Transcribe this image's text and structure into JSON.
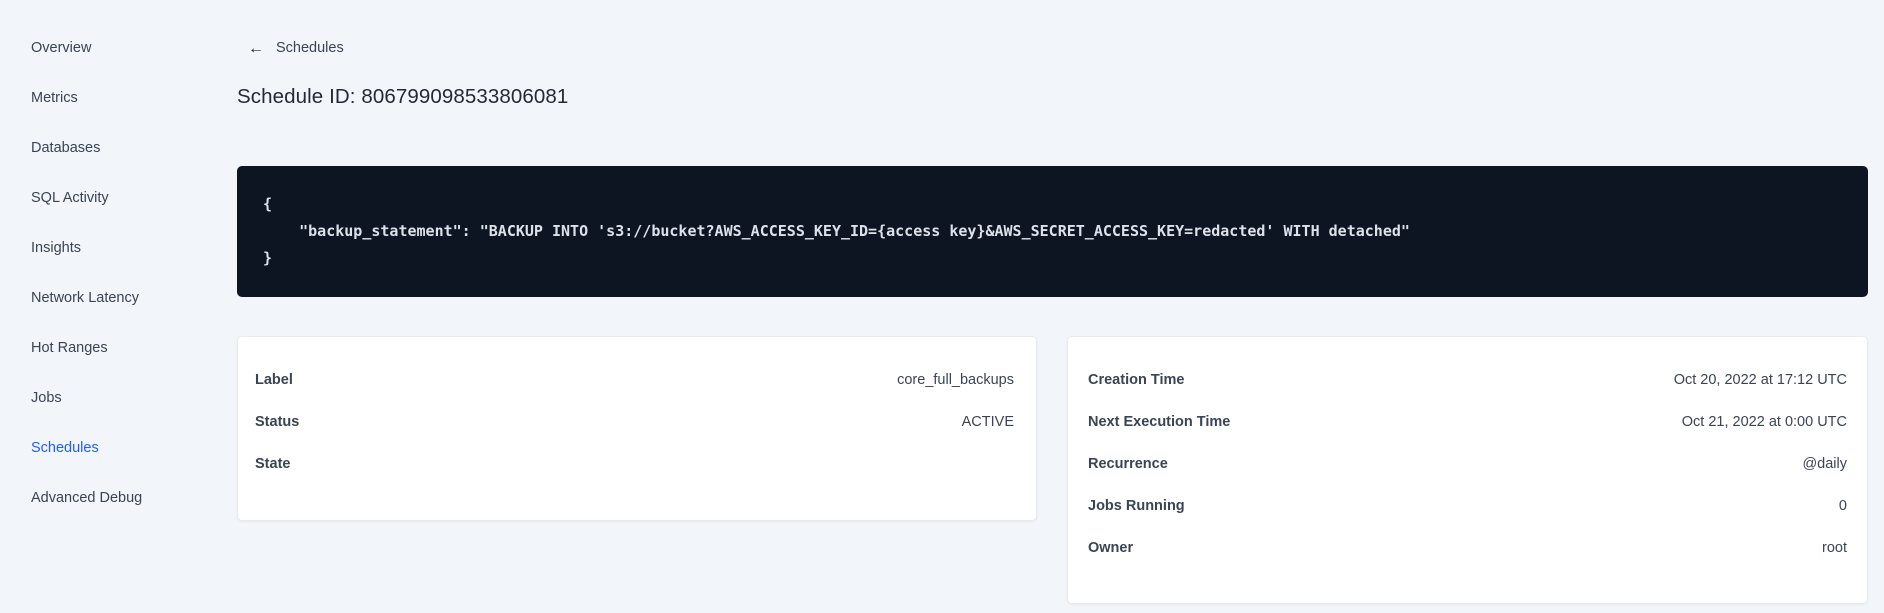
{
  "sidebar": {
    "items": [
      {
        "label": "Overview",
        "active": false
      },
      {
        "label": "Metrics",
        "active": false
      },
      {
        "label": "Databases",
        "active": false
      },
      {
        "label": "SQL Activity",
        "active": false
      },
      {
        "label": "Insights",
        "active": false
      },
      {
        "label": "Network Latency",
        "active": false
      },
      {
        "label": "Hot Ranges",
        "active": false
      },
      {
        "label": "Jobs",
        "active": false
      },
      {
        "label": "Schedules",
        "active": true
      },
      {
        "label": "Advanced Debug",
        "active": false
      }
    ]
  },
  "header": {
    "back_icon": "←",
    "back_label": "Schedules",
    "title": "Schedule ID: 806799098533806081"
  },
  "code_block": {
    "lines": [
      "{",
      "    \"backup_statement\": \"BACKUP INTO 's3://bucket?AWS_ACCESS_KEY_ID={access key}&AWS_SECRET_ACCESS_KEY=redacted' WITH detached\"",
      "}"
    ]
  },
  "details_card": {
    "rows": [
      {
        "label": "Label",
        "value": "core_full_backups"
      },
      {
        "label": "Status",
        "value": "ACTIVE"
      },
      {
        "label": "State",
        "value": ""
      }
    ]
  },
  "schedule_card": {
    "rows": [
      {
        "label": "Creation Time",
        "value": "Oct 20, 2022 at 17:12 UTC"
      },
      {
        "label": "Next Execution Time",
        "value": "Oct 21, 2022 at 0:00 UTC"
      },
      {
        "label": "Recurrence",
        "value": "@daily"
      },
      {
        "label": "Jobs Running",
        "value": "0"
      },
      {
        "label": "Owner",
        "value": "root"
      }
    ]
  },
  "colors": {
    "accent_link": "#1f5eff",
    "page_background": "#f2f5f9",
    "code_background": "#0e1522",
    "code_text": "#dde2ea",
    "text_primary": "#394455",
    "heading": "#242a35"
  }
}
